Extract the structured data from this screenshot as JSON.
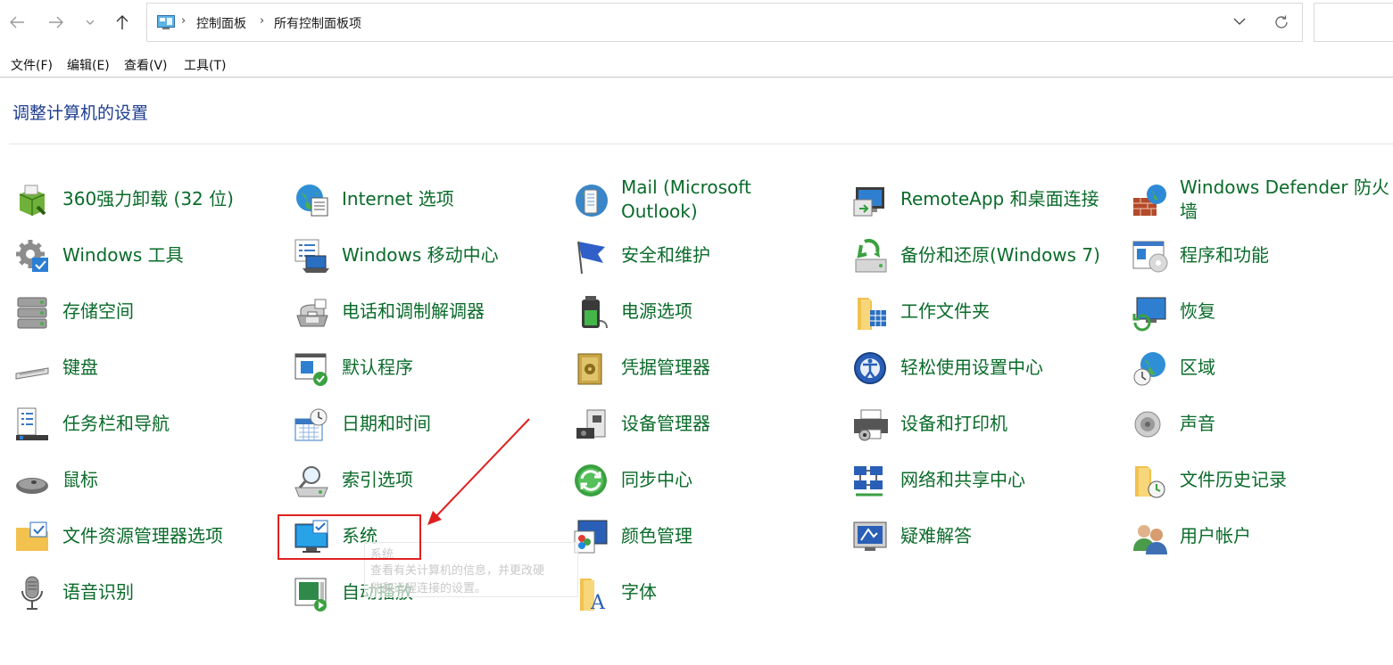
{
  "breadcrumb": [
    "控制面板",
    "所有控制面板项"
  ],
  "menu": [
    "文件(F)",
    "编辑(E)",
    "查看(V)",
    "工具(T)"
  ],
  "heading": "调整计算机的设置",
  "tooltip": {
    "title": "系统",
    "line1": "查看有关计算机的信息，并更改硬",
    "line2": "件和远程连接的设置。"
  },
  "items": [
    {
      "label": "360强力卸载 (32 位)",
      "icon": "uninstall-box-icon"
    },
    {
      "label": "Internet 选项",
      "icon": "globe-document-icon"
    },
    {
      "label": "Mail (Microsoft Outlook)",
      "label_line1": "Mail (Microsoft",
      "label_line2": "Outlook)",
      "icon": "mail-icon"
    },
    {
      "label": "RemoteApp 和桌面连接",
      "icon": "remoteapp-icon"
    },
    {
      "label": "Windows Defender 防火墙",
      "label_line1": "Windows Defender 防火",
      "label_line2": "墙",
      "icon": "firewall-icon"
    },
    {
      "label": "Windows 工具",
      "icon": "gear-tools-icon"
    },
    {
      "label": "Windows 移动中心",
      "icon": "mobility-center-icon"
    },
    {
      "label": "安全和维护",
      "icon": "flag-icon"
    },
    {
      "label": "备份和还原(Windows 7)",
      "icon": "backup-icon"
    },
    {
      "label": "程序和功能",
      "icon": "programs-icon"
    },
    {
      "label": "存储空间",
      "icon": "storage-icon"
    },
    {
      "label": "电话和调制解调器",
      "icon": "phone-modem-icon"
    },
    {
      "label": "电源选项",
      "icon": "battery-icon"
    },
    {
      "label": "工作文件夹",
      "icon": "work-folder-icon"
    },
    {
      "label": "恢复",
      "icon": "recovery-icon"
    },
    {
      "label": "键盘",
      "icon": "keyboard-icon"
    },
    {
      "label": "默认程序",
      "icon": "default-programs-icon"
    },
    {
      "label": "凭据管理器",
      "icon": "credential-vault-icon"
    },
    {
      "label": "轻松使用设置中心",
      "icon": "ease-of-access-icon"
    },
    {
      "label": "区域",
      "icon": "region-globe-icon"
    },
    {
      "label": "任务栏和导航",
      "icon": "taskbar-icon"
    },
    {
      "label": "日期和时间",
      "icon": "calendar-clock-icon"
    },
    {
      "label": "设备管理器",
      "icon": "device-manager-icon"
    },
    {
      "label": "设备和打印机",
      "icon": "printer-icon"
    },
    {
      "label": "声音",
      "icon": "speaker-icon"
    },
    {
      "label": "鼠标",
      "icon": "mouse-icon"
    },
    {
      "label": "索引选项",
      "icon": "index-magnifier-icon"
    },
    {
      "label": "同步中心",
      "icon": "sync-icon"
    },
    {
      "label": "网络和共享中心",
      "icon": "network-icon"
    },
    {
      "label": "文件历史记录",
      "icon": "file-history-icon"
    },
    {
      "label": "文件资源管理器选项",
      "icon": "folder-options-icon"
    },
    {
      "label": "系统",
      "icon": "system-monitor-icon"
    },
    {
      "label": "颜色管理",
      "icon": "color-management-icon"
    },
    {
      "label": "疑难解答",
      "icon": "troubleshoot-icon"
    },
    {
      "label": "用户帐户",
      "icon": "users-icon"
    },
    {
      "label": "语音识别",
      "icon": "microphone-icon"
    },
    {
      "label": "自动播放",
      "icon": "autoplay-icon"
    },
    {
      "label": "字体",
      "icon": "font-folder-icon"
    }
  ]
}
